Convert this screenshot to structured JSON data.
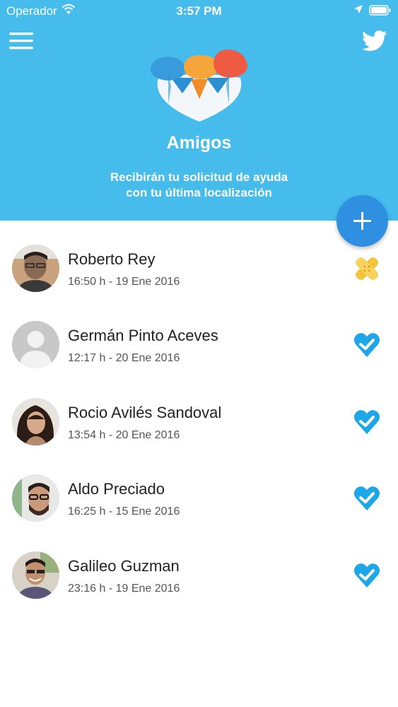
{
  "status_bar": {
    "carrier": "Operador",
    "time": "3:57 PM"
  },
  "header": {
    "title": "Amigos",
    "subtitle_line1": "Recibirán tu solicitud de ayuda",
    "subtitle_line2": "con tu última localización",
    "icons": [
      "menu-icon",
      "twitter-icon",
      "friends-logo",
      "plus-icon"
    ]
  },
  "colors": {
    "header_bg": "#45bcec",
    "fab_bg": "#2f8fe0",
    "status_ok": "#1ea7e8",
    "status_help": "#f5c33b"
  },
  "friends": [
    {
      "name": "Roberto Rey",
      "date": "16:50 h - 19 Ene 2016",
      "status_icon": "bandage-icon"
    },
    {
      "name": "Germán Pinto Aceves",
      "date": "12:17 h - 20 Ene 2016",
      "status_icon": "heart-check-icon"
    },
    {
      "name": "Rocio Avilés Sandoval",
      "date": "13:54 h - 20 Ene 2016",
      "status_icon": "heart-check-icon"
    },
    {
      "name": "Aldo Preciado",
      "date": "16:25 h - 15 Ene 2016",
      "status_icon": "heart-check-icon"
    },
    {
      "name": "Galileo Guzman",
      "date": "23:16 h - 19 Ene 2016",
      "status_icon": "heart-check-icon"
    }
  ]
}
